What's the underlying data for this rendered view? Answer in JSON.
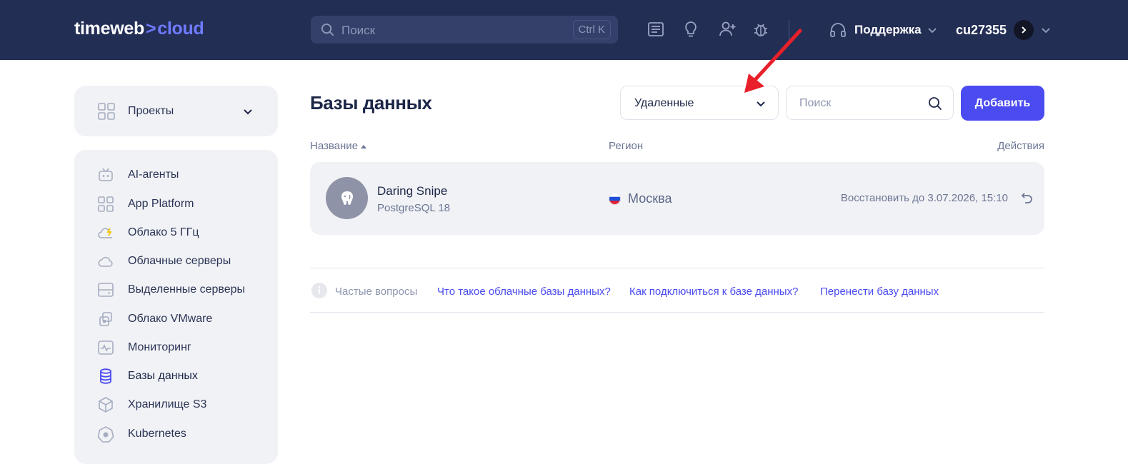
{
  "header": {
    "logo_main": "timeweb",
    "logo_arrow": ">",
    "logo_accent": "cloud",
    "search_placeholder": "Поиск",
    "search_shortcut": "Ctrl K",
    "support_label": "Поддержка",
    "account_name": "cu27355",
    "icons": [
      "news-icon",
      "idea-icon",
      "add-user-icon",
      "bug-icon",
      "headset-icon"
    ]
  },
  "sidebar": {
    "projects_label": "Проекты",
    "items": [
      {
        "label": "AI-агенты",
        "icon": "robot-icon"
      },
      {
        "label": "App Platform",
        "icon": "grid-icon"
      },
      {
        "label": "Облако 5 ГГц",
        "icon": "cloud-bolt-icon"
      },
      {
        "label": "Облачные серверы",
        "icon": "cloud-icon"
      },
      {
        "label": "Выделенные серверы",
        "icon": "server-icon"
      },
      {
        "label": "Облако VMware",
        "icon": "vmware-icon"
      },
      {
        "label": "Мониторинг",
        "icon": "monitoring-icon"
      },
      {
        "label": "Базы данных",
        "icon": "database-icon",
        "active": true
      },
      {
        "label": "Хранилище S3",
        "icon": "storage-icon"
      },
      {
        "label": "Kubernetes",
        "icon": "kubernetes-icon"
      }
    ]
  },
  "main": {
    "title": "Базы данных",
    "filter_value": "Удаленные",
    "search_placeholder": "Поиск",
    "add_button": "Добавить",
    "columns": {
      "name": "Название",
      "region": "Регион",
      "actions": "Действия"
    },
    "rows": [
      {
        "name": "Daring Snipe",
        "engine": "PostgreSQL 18",
        "region": "Москва",
        "action": "Восстановить до 3.07.2026, 15:10"
      }
    ],
    "faq": {
      "label": "Частые вопросы",
      "links": [
        "Что такое облачные базы данных?",
        "Как подключиться к базе данных?",
        "Перенести базу данных"
      ]
    }
  },
  "colors": {
    "header_bg": "#232e55",
    "accent": "#4a4bf0",
    "annotation_arrow": "#e8202a"
  }
}
